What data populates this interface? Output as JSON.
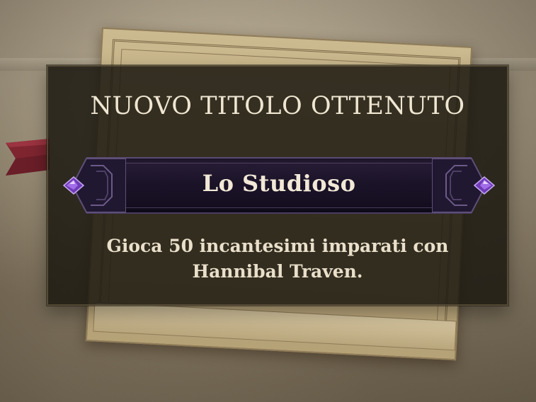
{
  "achievement": {
    "heading": "NUOVO TITOLO OTTENUTO",
    "title_name": "Lo Studioso",
    "description": "Gioca 50 incantesimi imparati con Hannibal Traven."
  },
  "icons": {
    "ribbon": "bookmark-ribbon-icon",
    "gem_left": "purple-gem-icon",
    "gem_right": "purple-gem-icon"
  },
  "colors": {
    "panel_bg": "#1c1810",
    "banner_bg": "#1b1328",
    "gem": "#8a4fd6",
    "ribbon": "#8a2a35",
    "text": "#efe6d2"
  }
}
